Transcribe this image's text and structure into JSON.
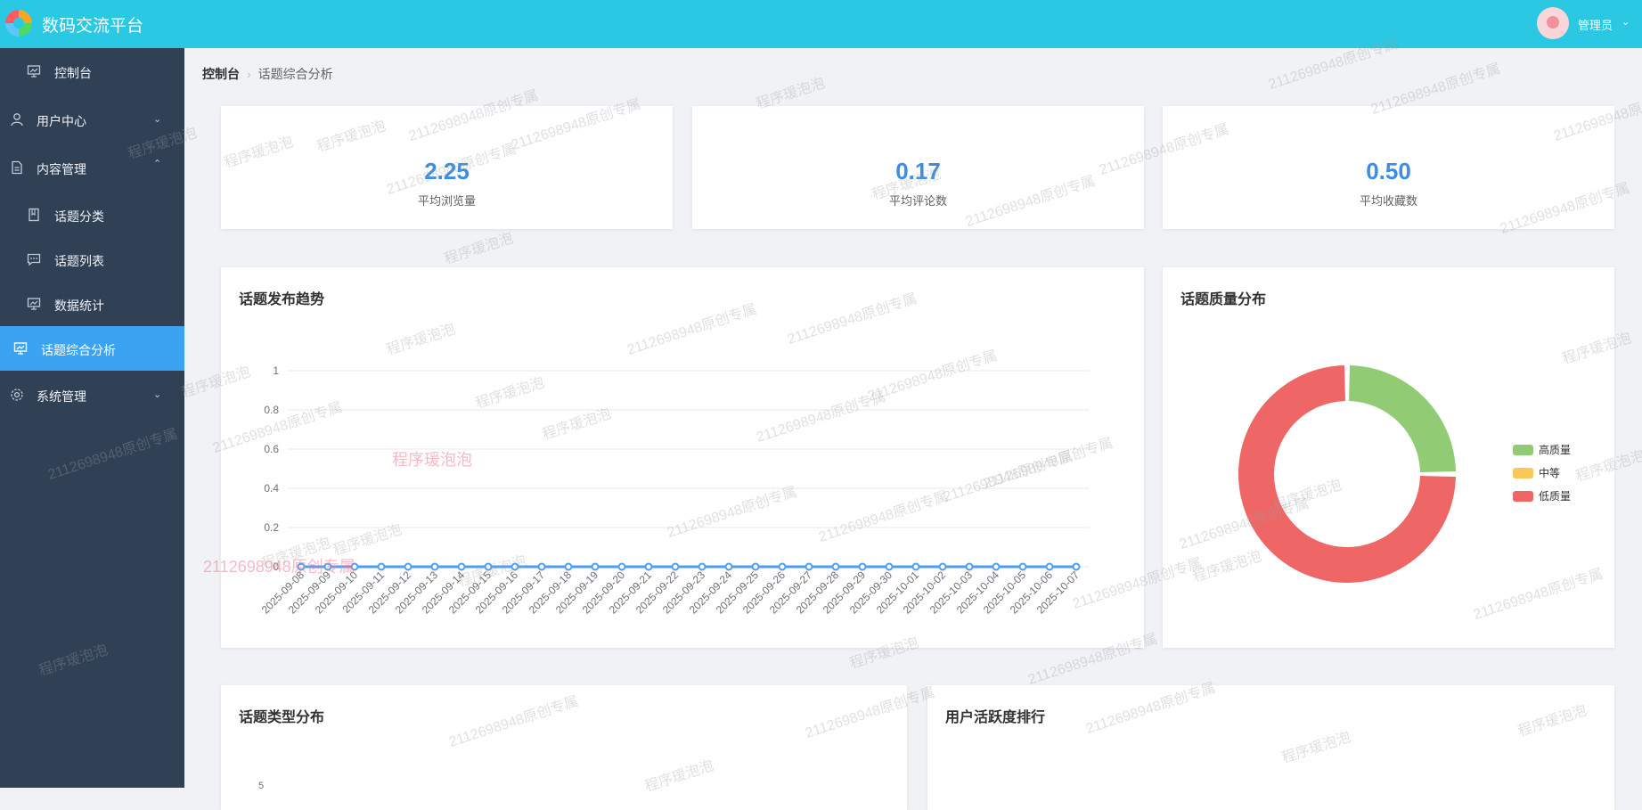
{
  "app": {
    "title": "数码交流平台"
  },
  "header": {
    "user_name": "管理员"
  },
  "sidebar": {
    "items": [
      {
        "label": "控制台",
        "icon": "dashboard-icon"
      },
      {
        "label": "用户中心",
        "icon": "user-icon"
      },
      {
        "label": "内容管理",
        "icon": "document-icon"
      },
      {
        "label": "话题分类",
        "icon": "bookmark-icon"
      },
      {
        "label": "话题列表",
        "icon": "comment-icon"
      },
      {
        "label": "数据统计",
        "icon": "chart-icon"
      },
      {
        "label": "话题综合分析",
        "icon": "analysis-icon"
      },
      {
        "label": "系统管理",
        "icon": "gear-icon"
      }
    ]
  },
  "breadcrumb": {
    "home": "控制台",
    "current": "话题综合分析"
  },
  "stats": [
    {
      "value": "2.25",
      "label": "平均浏览量"
    },
    {
      "value": "0.17",
      "label": "平均评论数"
    },
    {
      "value": "0.50",
      "label": "平均收藏数"
    }
  ],
  "panels": {
    "trend_title": "话题发布趋势",
    "quality_title": "话题质量分布",
    "type_title": "话题类型分布",
    "activity_title": "用户活跃度排行"
  },
  "type_chart_top_tick": "5",
  "colors": {
    "header": "#2ac8e3",
    "sidebar": "#304156",
    "active": "#3aa3f2",
    "accent": "#3a8ee6",
    "line": "#4a9ff5",
    "good": "#91cc75",
    "medium": "#fac858",
    "low": "#ee6666"
  },
  "chart_data": [
    {
      "type": "line",
      "x": [
        "2025-09-08",
        "2025-09-09",
        "2025-09-10",
        "2025-09-11",
        "2025-09-12",
        "2025-09-13",
        "2025-09-14",
        "2025-09-15",
        "2025-09-16",
        "2025-09-17",
        "2025-09-18",
        "2025-09-19",
        "2025-09-20",
        "2025-09-21",
        "2025-09-22",
        "2025-09-23",
        "2025-09-24",
        "2025-09-25",
        "2025-09-26",
        "2025-09-27",
        "2025-09-28",
        "2025-09-29",
        "2025-09-30",
        "2025-10-01",
        "2025-10-02",
        "2025-10-03",
        "2025-10-04",
        "2025-10-05",
        "2025-10-06",
        "2025-10-07"
      ],
      "y": [
        0,
        0,
        0,
        0,
        0,
        0,
        0,
        0,
        0,
        0,
        0,
        0,
        0,
        0,
        0,
        0,
        0,
        0,
        0,
        0,
        0,
        0,
        0,
        0,
        0,
        0,
        0,
        0,
        0,
        0
      ],
      "yticks": [
        "0",
        "0.2",
        "0.4",
        "0.6",
        "0.8",
        "1"
      ],
      "ylim": [
        0,
        1
      ],
      "grid": true
    },
    {
      "type": "pie",
      "labels": [
        "高质量",
        "中等",
        "低质量"
      ],
      "values": [
        25,
        0,
        75
      ],
      "colors": [
        "#91cc75",
        "#fac858",
        "#ee6666"
      ],
      "legend": "right"
    }
  ],
  "watermarks": [
    "2112698948原创专属",
    "程序瑗泡泡"
  ]
}
